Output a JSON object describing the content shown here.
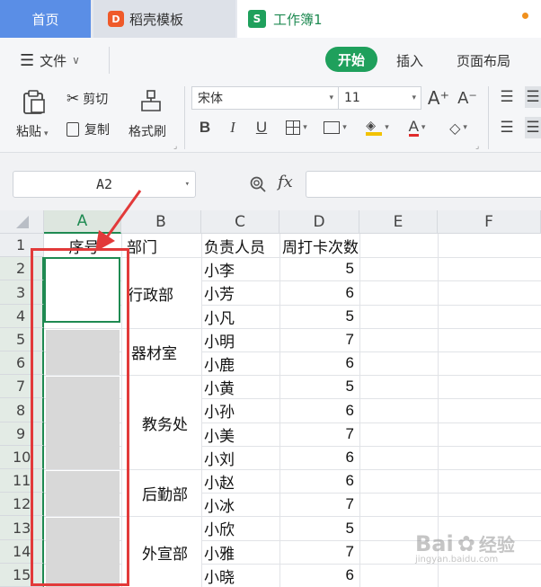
{
  "tabs": {
    "home": "首页",
    "docer": "稻壳模板",
    "workbook": "工作簿1",
    "docer_icon": "D",
    "s_icon": "S"
  },
  "menu": {
    "file": "文件",
    "start": "开始",
    "insert": "插入",
    "layout": "页面布局"
  },
  "ribbon": {
    "paste": "粘贴",
    "cut": "剪切",
    "copy": "复制",
    "format_painter": "格式刷",
    "font_name": "宋体",
    "font_size": "11",
    "bold": "B",
    "italic": "I",
    "underline": "U",
    "grow_font": "A⁺",
    "shrink_font": "A⁻",
    "font_color": "A"
  },
  "formula_bar": {
    "name_box": "A2",
    "fx": "fx"
  },
  "columns": [
    "A",
    "B",
    "C",
    "D",
    "E",
    "F"
  ],
  "rows": [
    "1",
    "2",
    "3",
    "4",
    "5",
    "6",
    "7",
    "8",
    "9",
    "10",
    "11",
    "12",
    "13",
    "14",
    "15"
  ],
  "header_row": {
    "a": "序号",
    "b": "部门",
    "c": "负责人员",
    "d": "周打卡次数"
  },
  "departments": [
    "行政部",
    "器材室",
    "教务处",
    "后勤部",
    "外宣部"
  ],
  "people": [
    "小李",
    "小芳",
    "小凡",
    "小明",
    "小鹿",
    "小黄",
    "小孙",
    "小美",
    "小刘",
    "小赵",
    "小冰",
    "小欣",
    "小雅",
    "小晓"
  ],
  "counts": [
    "5",
    "6",
    "5",
    "7",
    "6",
    "5",
    "6",
    "7",
    "6",
    "6",
    "7",
    "5",
    "7",
    "6"
  ],
  "watermark": {
    "brand": "Bai",
    "suffix": "经验",
    "url": "jingyan.baidu.com"
  },
  "colors": {
    "accent_green": "#1fa05c",
    "home_tab": "#5a8ee6",
    "highlight_red": "#e23a3a"
  }
}
